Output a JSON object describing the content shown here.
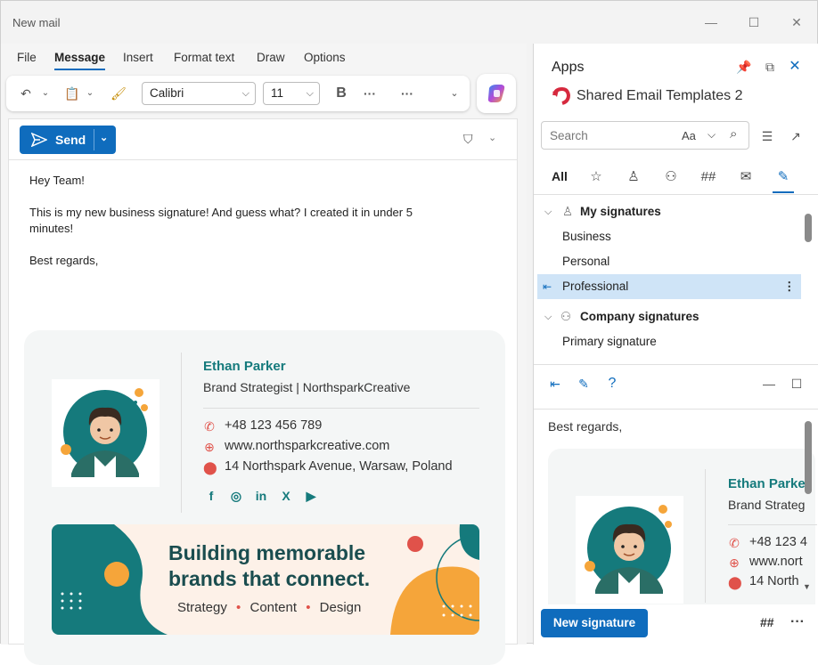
{
  "window": {
    "title": "New mail"
  },
  "menu": [
    "File",
    "Message",
    "Insert",
    "Format text",
    "Draw",
    "Options"
  ],
  "ribbon": {
    "font": "Calibri",
    "size": "11"
  },
  "send": {
    "label": "Send"
  },
  "email": {
    "greeting": "Hey Team!",
    "line1": "This is my new business signature! And guess what? I created it in under 5",
    "line2": "minutes!",
    "closing": "Best regards,"
  },
  "signature": {
    "name": "Ethan Parker",
    "role": "Brand Strategist | NorthsparkCreative",
    "phone": "+48 123 456 789",
    "website": "www.northsparkcreative.com",
    "address": "14 Northspark Avenue, Warsaw, Poland",
    "socials": [
      "f",
      "◎",
      "in",
      "X",
      "▶"
    ],
    "banner": {
      "headline1": "Building memorable",
      "headline2": "brands that connect.",
      "tag1": "Strategy",
      "tag2": "Content",
      "tag3": "Design"
    },
    "accent_color": "#157a7c",
    "orange_color": "#f5a53a"
  },
  "panel": {
    "title": "Apps",
    "app_name": "Shared Email Templates 2",
    "search_placeholder": "Search",
    "search_aa": "Aa",
    "tab_all": "All",
    "groups": {
      "my": "My signatures",
      "company": "Company signatures"
    },
    "items": [
      "Business",
      "Personal",
      "Professional",
      "Primary signature"
    ],
    "preview": {
      "closing": "Best regards,",
      "name": "Ethan Parke",
      "role": "Brand Strateg",
      "phone": "+48 123 4",
      "website": "www.nort",
      "address": "14 North"
    },
    "new_signature": "New signature",
    "hash": "##"
  }
}
